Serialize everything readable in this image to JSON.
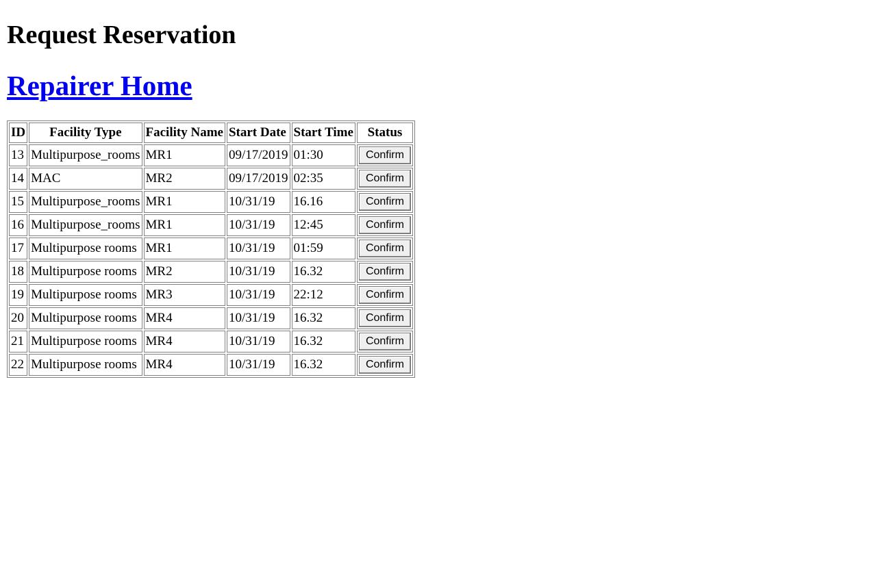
{
  "page": {
    "title": "Request Reservation",
    "home_link": "Repairer Home"
  },
  "table": {
    "headers": {
      "id": "ID",
      "facility_type": "Facility Type",
      "facility_name": "Facility Name",
      "start_date": "Start Date",
      "start_time": "Start Time",
      "status": "Status"
    },
    "rows": [
      {
        "id": "13",
        "facility_type": "Multipurpose_rooms",
        "facility_name": "MR1",
        "start_date": "09/17/2019",
        "start_time": "01:30",
        "action": "Confirm"
      },
      {
        "id": "14",
        "facility_type": "MAC",
        "facility_name": "MR2",
        "start_date": "09/17/2019",
        "start_time": "02:35",
        "action": "Confirm"
      },
      {
        "id": "15",
        "facility_type": "Multipurpose_rooms",
        "facility_name": "MR1",
        "start_date": "10/31/19",
        "start_time": "16.16",
        "action": "Confirm"
      },
      {
        "id": "16",
        "facility_type": "Multipurpose_rooms",
        "facility_name": "MR1",
        "start_date": "10/31/19",
        "start_time": "12:45",
        "action": "Confirm"
      },
      {
        "id": "17",
        "facility_type": "Multipurpose rooms",
        "facility_name": "MR1",
        "start_date": "10/31/19",
        "start_time": "01:59",
        "action": "Confirm"
      },
      {
        "id": "18",
        "facility_type": "Multipurpose rooms",
        "facility_name": "MR2",
        "start_date": "10/31/19",
        "start_time": "16.32",
        "action": "Confirm"
      },
      {
        "id": "19",
        "facility_type": "Multipurpose rooms",
        "facility_name": "MR3",
        "start_date": "10/31/19",
        "start_time": "22:12",
        "action": "Confirm"
      },
      {
        "id": "20",
        "facility_type": "Multipurpose rooms",
        "facility_name": "MR4",
        "start_date": "10/31/19",
        "start_time": "16.32",
        "action": "Confirm"
      },
      {
        "id": "21",
        "facility_type": "Multipurpose rooms",
        "facility_name": "MR4",
        "start_date": "10/31/19",
        "start_time": "16.32",
        "action": "Confirm"
      },
      {
        "id": "22",
        "facility_type": "Multipurpose rooms",
        "facility_name": "MR4",
        "start_date": "10/31/19",
        "start_time": "16.32",
        "action": "Confirm"
      }
    ]
  },
  "colors": {
    "link": "#0000ee",
    "border": "#808080",
    "button_bg": "#efefef"
  }
}
